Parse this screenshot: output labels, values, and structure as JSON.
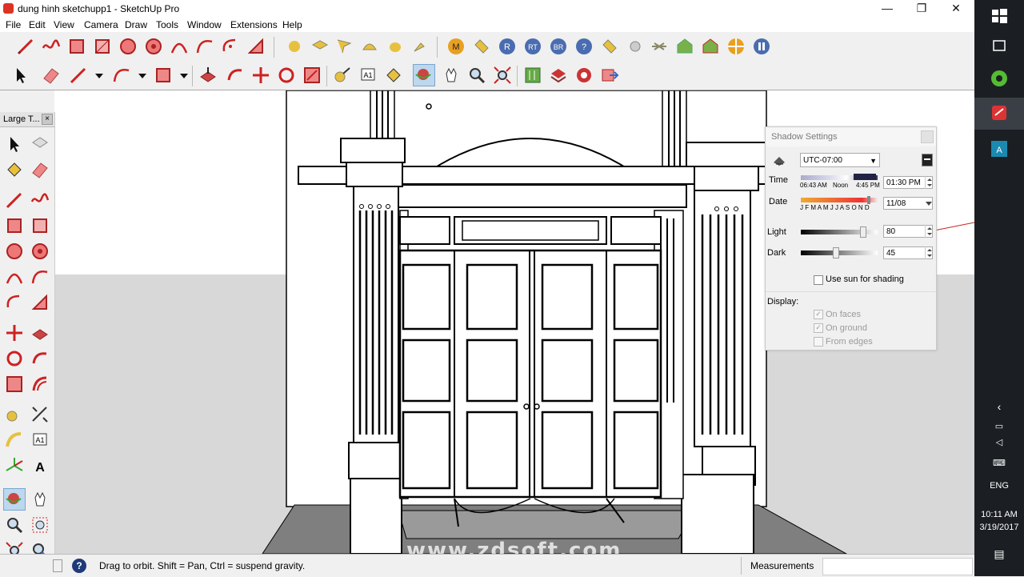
{
  "window": {
    "title": "dung hinh sketchupp1 - SketchUp Pro",
    "minimize": "—",
    "restore": "❐",
    "close": "✕"
  },
  "menu": [
    "File",
    "Edit",
    "View",
    "Camera",
    "Draw",
    "Tools",
    "Window",
    "Extensions",
    "Help"
  ],
  "palette": {
    "title": "Large T...",
    "close": "×"
  },
  "shadow_settings": {
    "title": "Shadow Settings",
    "timezone": "UTC-07:00",
    "time_label": "Time",
    "time_sunrise": "06:43 AM",
    "time_noon": "Noon",
    "time_sunset": "4:45 PM",
    "time_value": "01:30 PM",
    "date_label": "Date",
    "months": "J F M A M J J A S O N D",
    "date_value": "11/08",
    "light_label": "Light",
    "light_value": "80",
    "light_level": 0.8,
    "dark_label": "Dark",
    "dark_value": "45",
    "dark_level": 0.45,
    "use_sun_label": "Use sun for shading",
    "display_label": "Display:",
    "on_faces_label": "On faces",
    "on_ground_label": "On ground",
    "from_edges_label": "From edges"
  },
  "status": {
    "hint": "Drag to orbit. Shift = Pan, Ctrl = suspend gravity.",
    "measurements_label": "Measurements",
    "help_icon": "?"
  },
  "watermark": "www.zdsoft.com",
  "taskbar": {
    "language": "ENG",
    "time": "10:11 AM",
    "date": "3/19/2017"
  },
  "colors": {
    "accent_red": "#cc2222",
    "taskbar_bg": "#1b1f23",
    "sky": "#ffffff",
    "ground": "#d8d8d8"
  }
}
